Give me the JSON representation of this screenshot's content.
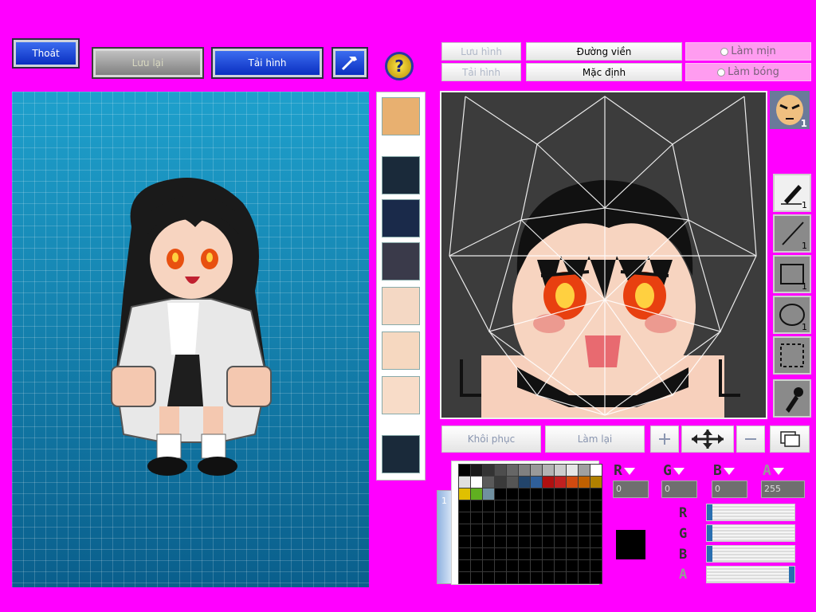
{
  "toolbar": {
    "exit_label": "Thoát",
    "save_label": "Lưu lại",
    "reload_label": "Tải hình",
    "hammer_icon": "hammer-icon",
    "help_icon": "help-icon"
  },
  "editor_tabs": {
    "save_image": "Lưu hình",
    "load_image": "Tải hình",
    "outline": "Đường viền",
    "default": "Mặc định",
    "smooth": "Làm mịn",
    "shading": "Làm bóng"
  },
  "avatar_badge": {
    "count": "1"
  },
  "tools": [
    {
      "name": "pen-tool",
      "icon": "pen-icon",
      "count": "1"
    },
    {
      "name": "line-tool",
      "icon": "line-icon",
      "count": "1"
    },
    {
      "name": "rect-tool",
      "icon": "rectangle-icon",
      "count": "1"
    },
    {
      "name": "ellipse-tool",
      "icon": "ellipse-icon",
      "count": "1"
    },
    {
      "name": "select-tool",
      "icon": "select-icon",
      "count": ""
    },
    {
      "name": "eyedropper-tool",
      "icon": "eyedropper-icon",
      "count": ""
    }
  ],
  "bottom_buttons": {
    "restore": "Khôi phục",
    "redo": "Làm lại"
  },
  "color": {
    "r_label": "R",
    "g_label": "G",
    "b_label": "B",
    "a_label": "A",
    "r": "0",
    "g": "0",
    "b": "0",
    "a": "255",
    "current": "#000000"
  },
  "layers": {
    "active": "1"
  },
  "palette": [
    "#000000",
    "#1a1a1a",
    "#333333",
    "#4d4d4d",
    "#666666",
    "#808080",
    "#999999",
    "#b3b3b3",
    "#cccccc",
    "#e6e6e6",
    "#a0a0a0",
    "#ffffff",
    "#e0e0e0",
    "#ffffff",
    "#5a5a5a",
    "#3a3a3a",
    "#555555",
    "#22446a",
    "#2f5f9a",
    "#b01010",
    "#c02020",
    "#d04a10",
    "#c06000",
    "#b08000",
    "#e0c000",
    "#60b020",
    "#7090a0"
  ]
}
